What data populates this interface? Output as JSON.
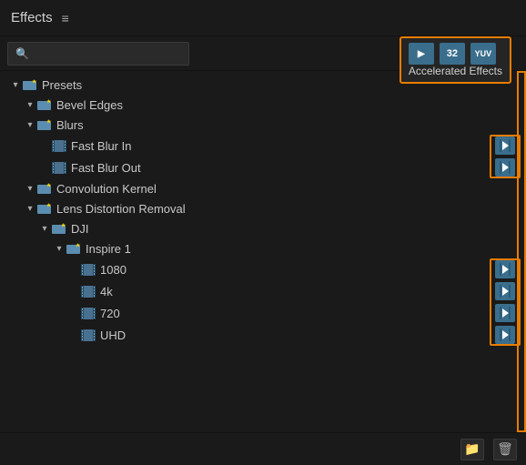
{
  "panel": {
    "title": "Effects",
    "menu_icon": "≡"
  },
  "search": {
    "placeholder": ""
  },
  "accel_popup": {
    "label": "Accelerated Effects",
    "num": "32",
    "yuv": "YUV"
  },
  "tree": {
    "items": [
      {
        "id": "presets",
        "level": 0,
        "chevron": "open",
        "icon": "folder-star",
        "label": "Presets",
        "badge": false
      },
      {
        "id": "bevel",
        "level": 1,
        "chevron": "open",
        "icon": "folder-star",
        "label": "Bevel Edges",
        "badge": false
      },
      {
        "id": "blurs",
        "level": 1,
        "chevron": "open",
        "icon": "folder-star",
        "label": "Blurs",
        "badge": false
      },
      {
        "id": "fbi",
        "level": 2,
        "chevron": "none",
        "icon": "effect",
        "label": "Fast Blur In",
        "badge": true
      },
      {
        "id": "fbo",
        "level": 2,
        "chevron": "none",
        "icon": "effect",
        "label": "Fast Blur Out",
        "badge": true
      },
      {
        "id": "conv",
        "level": 1,
        "chevron": "open",
        "icon": "folder-star",
        "label": "Convolution Kernel",
        "badge": false
      },
      {
        "id": "lens",
        "level": 1,
        "chevron": "open",
        "icon": "folder-star",
        "label": "Lens Distortion Removal",
        "badge": false
      },
      {
        "id": "dji",
        "level": 2,
        "chevron": "open",
        "icon": "folder-star",
        "label": "DJI",
        "badge": false
      },
      {
        "id": "inspire",
        "level": 3,
        "chevron": "open",
        "icon": "folder-star",
        "label": "Inspire 1",
        "badge": false
      },
      {
        "id": "p1080",
        "level": 4,
        "chevron": "none",
        "icon": "effect",
        "label": "1080",
        "badge": true
      },
      {
        "id": "p4k",
        "level": 4,
        "chevron": "none",
        "icon": "effect",
        "label": "4k",
        "badge": true
      },
      {
        "id": "p720",
        "level": 4,
        "chevron": "none",
        "icon": "effect",
        "label": "720",
        "badge": true
      },
      {
        "id": "puhd",
        "level": 4,
        "chevron": "none",
        "icon": "effect",
        "label": "UHD",
        "badge": true
      }
    ]
  },
  "bottom": {
    "new_bin_label": "New Bin",
    "delete_label": "Delete"
  }
}
